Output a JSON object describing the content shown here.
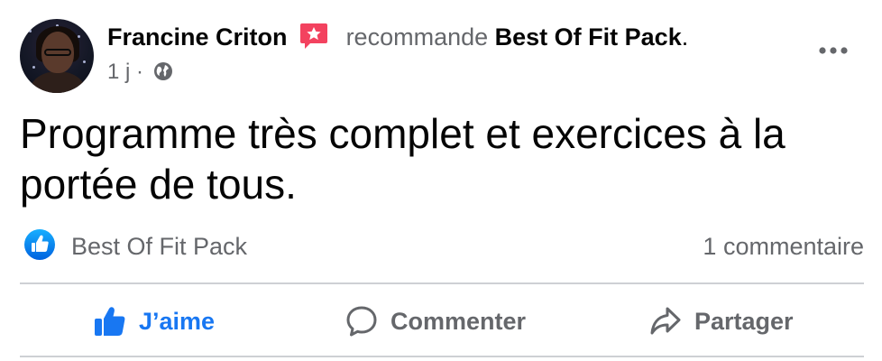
{
  "post": {
    "author": "Francine Criton",
    "verb": "recommande",
    "page_name": "Best Of Fit Pack",
    "punct": ".",
    "time": "1 j",
    "time_separator": "·",
    "text": "Programme très complet et exercices à la portée de tous."
  },
  "reactions": {
    "reactor_name": "Best Of Fit Pack",
    "comments_label": "1 commentaire"
  },
  "actions": {
    "like_label": "J’aime",
    "comment_label": "Commenter",
    "share_label": "Partager"
  },
  "colors": {
    "accent": "#1877f2",
    "recommend_badge": "#f3425f",
    "secondary_text": "#65676b",
    "divider": "#ced0d4"
  },
  "icons": {
    "recommend": "star-speech-bubble-icon",
    "privacy": "globe-icon",
    "options": "more-options-icon",
    "reaction": "thumbs-up-icon",
    "like": "thumbs-up-icon",
    "comment": "comment-bubble-icon",
    "share": "share-arrow-icon"
  }
}
